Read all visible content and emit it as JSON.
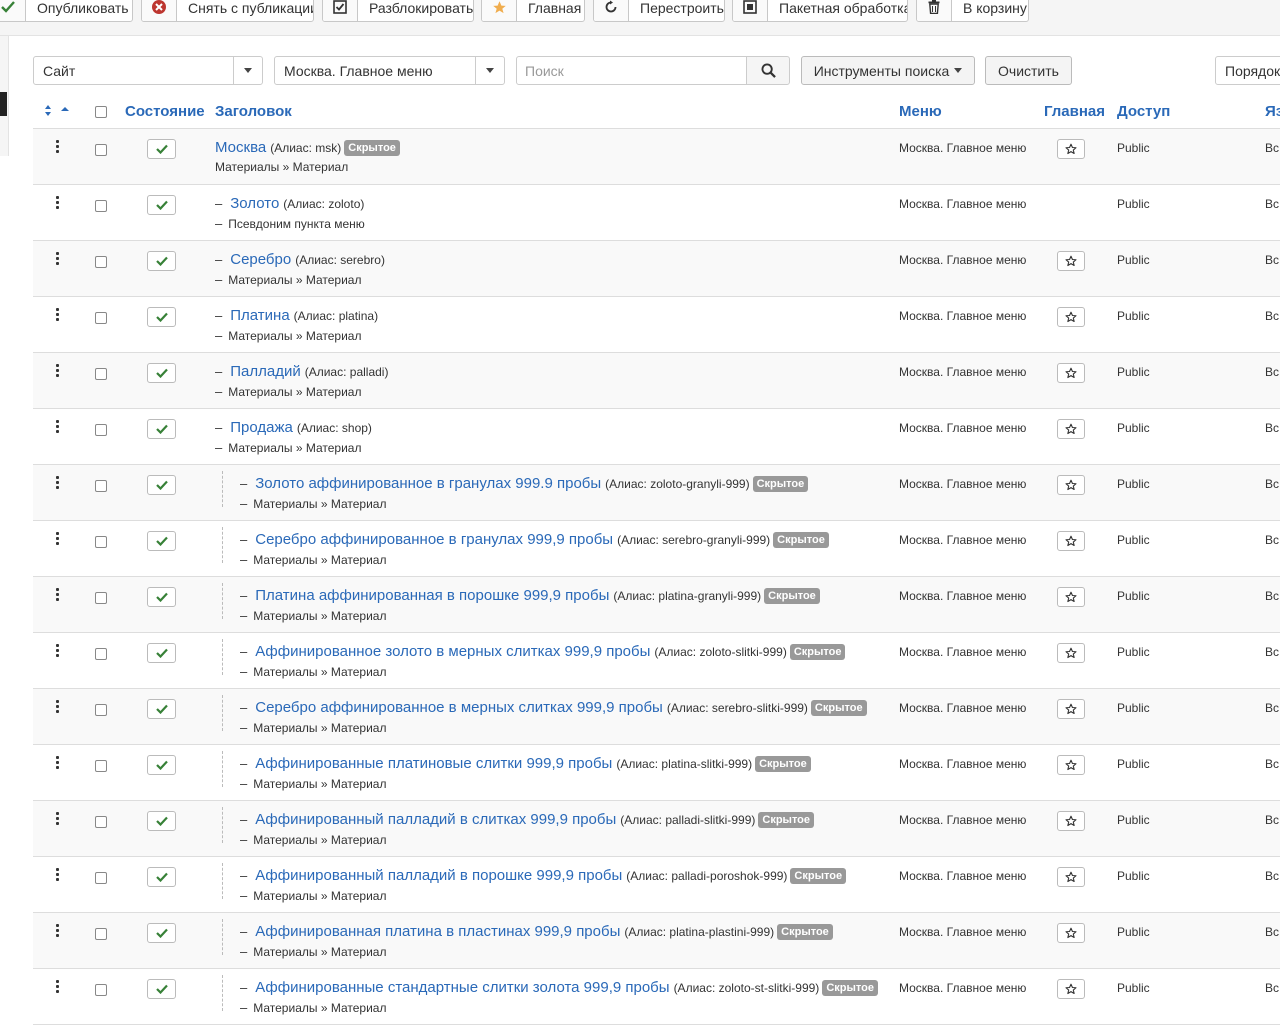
{
  "toolbar": {
    "publish": "Опубликовать",
    "unpublish": "Снять с публикации",
    "checkin": "Разблокировать",
    "home": "Главная",
    "rebuild": "Перестроить",
    "batch": "Пакетная обработка",
    "trash": "В корзину"
  },
  "filters": {
    "site": "Сайт",
    "menu": "Москва. Главное меню",
    "search_placeholder": "Поиск",
    "search_tools": "Инструменты поиска",
    "clear": "Очистить",
    "ordering": "Порядок"
  },
  "table": {
    "headers": {
      "state": "Состояние",
      "title": "Заголовок",
      "menu": "Меню",
      "home": "Главная",
      "access": "Доступ",
      "language": "Яз"
    },
    "rows": [
      {
        "level": 1,
        "title": "Москва",
        "alias": "(Алиас: msk)",
        "badge": "Скрытое",
        "type": "Материалы » Материал",
        "menu": "Москва. Главное меню",
        "access": "Public",
        "lang": "Вс",
        "home": true
      },
      {
        "level": 2,
        "title": "Золото",
        "alias": "(Алиас: zoloto)",
        "badge": "",
        "type": "Псевдоним пункта меню",
        "menu": "Москва. Главное меню",
        "access": "Public",
        "lang": "Вс",
        "home": false
      },
      {
        "level": 2,
        "title": "Серебро",
        "alias": "(Алиас: serebro)",
        "badge": "",
        "type": "Материалы » Материал",
        "menu": "Москва. Главное меню",
        "access": "Public",
        "lang": "Вс",
        "home": true
      },
      {
        "level": 2,
        "title": "Платина",
        "alias": "(Алиас: platina)",
        "badge": "",
        "type": "Материалы » Материал",
        "menu": "Москва. Главное меню",
        "access": "Public",
        "lang": "Вс",
        "home": true
      },
      {
        "level": 2,
        "title": "Палладий",
        "alias": "(Алиас: palladi)",
        "badge": "",
        "type": "Материалы » Материал",
        "menu": "Москва. Главное меню",
        "access": "Public",
        "lang": "Вс",
        "home": true
      },
      {
        "level": 2,
        "title": "Продажа",
        "alias": "(Алиас: shop)",
        "badge": "",
        "type": "Материалы » Материал",
        "menu": "Москва. Главное меню",
        "access": "Public",
        "lang": "Вс",
        "home": true
      },
      {
        "level": 3,
        "title": "Золото аффинированное в гранулах 999.9 пробы",
        "alias": "(Алиас: zoloto-granyli-999)",
        "badge": "Скрытое",
        "type": "Материалы » Материал",
        "menu": "Москва. Главное меню",
        "access": "Public",
        "lang": "Вс",
        "home": true
      },
      {
        "level": 3,
        "title": "Серебро аффинированное в гранулах 999,9 пробы",
        "alias": "(Алиас: serebro-granyli-999)",
        "badge": "Скрытое",
        "type": "Материалы » Материал",
        "menu": "Москва. Главное меню",
        "access": "Public",
        "lang": "Вс",
        "home": true
      },
      {
        "level": 3,
        "title": "Платина аффинированная в порошке 999,9 пробы",
        "alias": "(Алиас: platina-granyli-999)",
        "badge": "Скрытое",
        "type": "Материалы » Материал",
        "menu": "Москва. Главное меню",
        "access": "Public",
        "lang": "Вс",
        "home": true
      },
      {
        "level": 3,
        "title": "Аффинированное золото в мерных слитках 999,9 пробы",
        "alias": "(Алиас: zoloto-slitki-999)",
        "badge": "Скрытое",
        "type": "Материалы » Материал",
        "menu": "Москва. Главное меню",
        "access": "Public",
        "lang": "Вс",
        "home": true
      },
      {
        "level": 3,
        "title": "Серебро аффинированное в мерных слитках 999,9 пробы",
        "alias": "(Алиас: serebro-slitki-999)",
        "badge": "Скрытое",
        "type": "Материалы » Материал",
        "menu": "Москва. Главное меню",
        "access": "Public",
        "lang": "Вс",
        "home": true
      },
      {
        "level": 3,
        "title": "Аффинированные платиновые слитки 999,9 пробы",
        "alias": "(Алиас: platina-slitki-999)",
        "badge": "Скрытое",
        "type": "Материалы » Материал",
        "menu": "Москва. Главное меню",
        "access": "Public",
        "lang": "Вс",
        "home": true
      },
      {
        "level": 3,
        "title": "Аффинированный палладий в слитках 999,9 пробы",
        "alias": "(Алиас: palladi-slitki-999)",
        "badge": "Скрытое",
        "type": "Материалы » Материал",
        "menu": "Москва. Главное меню",
        "access": "Public",
        "lang": "Вс",
        "home": true
      },
      {
        "level": 3,
        "title": "Аффинированный палладий в порошке 999,9 пробы",
        "alias": "(Алиас: palladi-poroshok-999)",
        "badge": "Скрытое",
        "type": "Материалы » Материал",
        "menu": "Москва. Главное меню",
        "access": "Public",
        "lang": "Вс",
        "home": true
      },
      {
        "level": 3,
        "title": "Аффинированная платина в пластинах 999,9 пробы",
        "alias": "(Алиас: platina-plastini-999)",
        "badge": "Скрытое",
        "type": "Материалы » Материал",
        "menu": "Москва. Главное меню",
        "access": "Public",
        "lang": "Вс",
        "home": true
      },
      {
        "level": 3,
        "title": "Аффинированные стандартные слитки золота 999,9 пробы",
        "alias": "(Алиас: zoloto-st-slitki-999)",
        "badge": "Скрытое",
        "type": "Материалы » Материал",
        "menu": "Москва. Главное меню",
        "access": "Public",
        "lang": "Вс",
        "home": true
      }
    ]
  }
}
